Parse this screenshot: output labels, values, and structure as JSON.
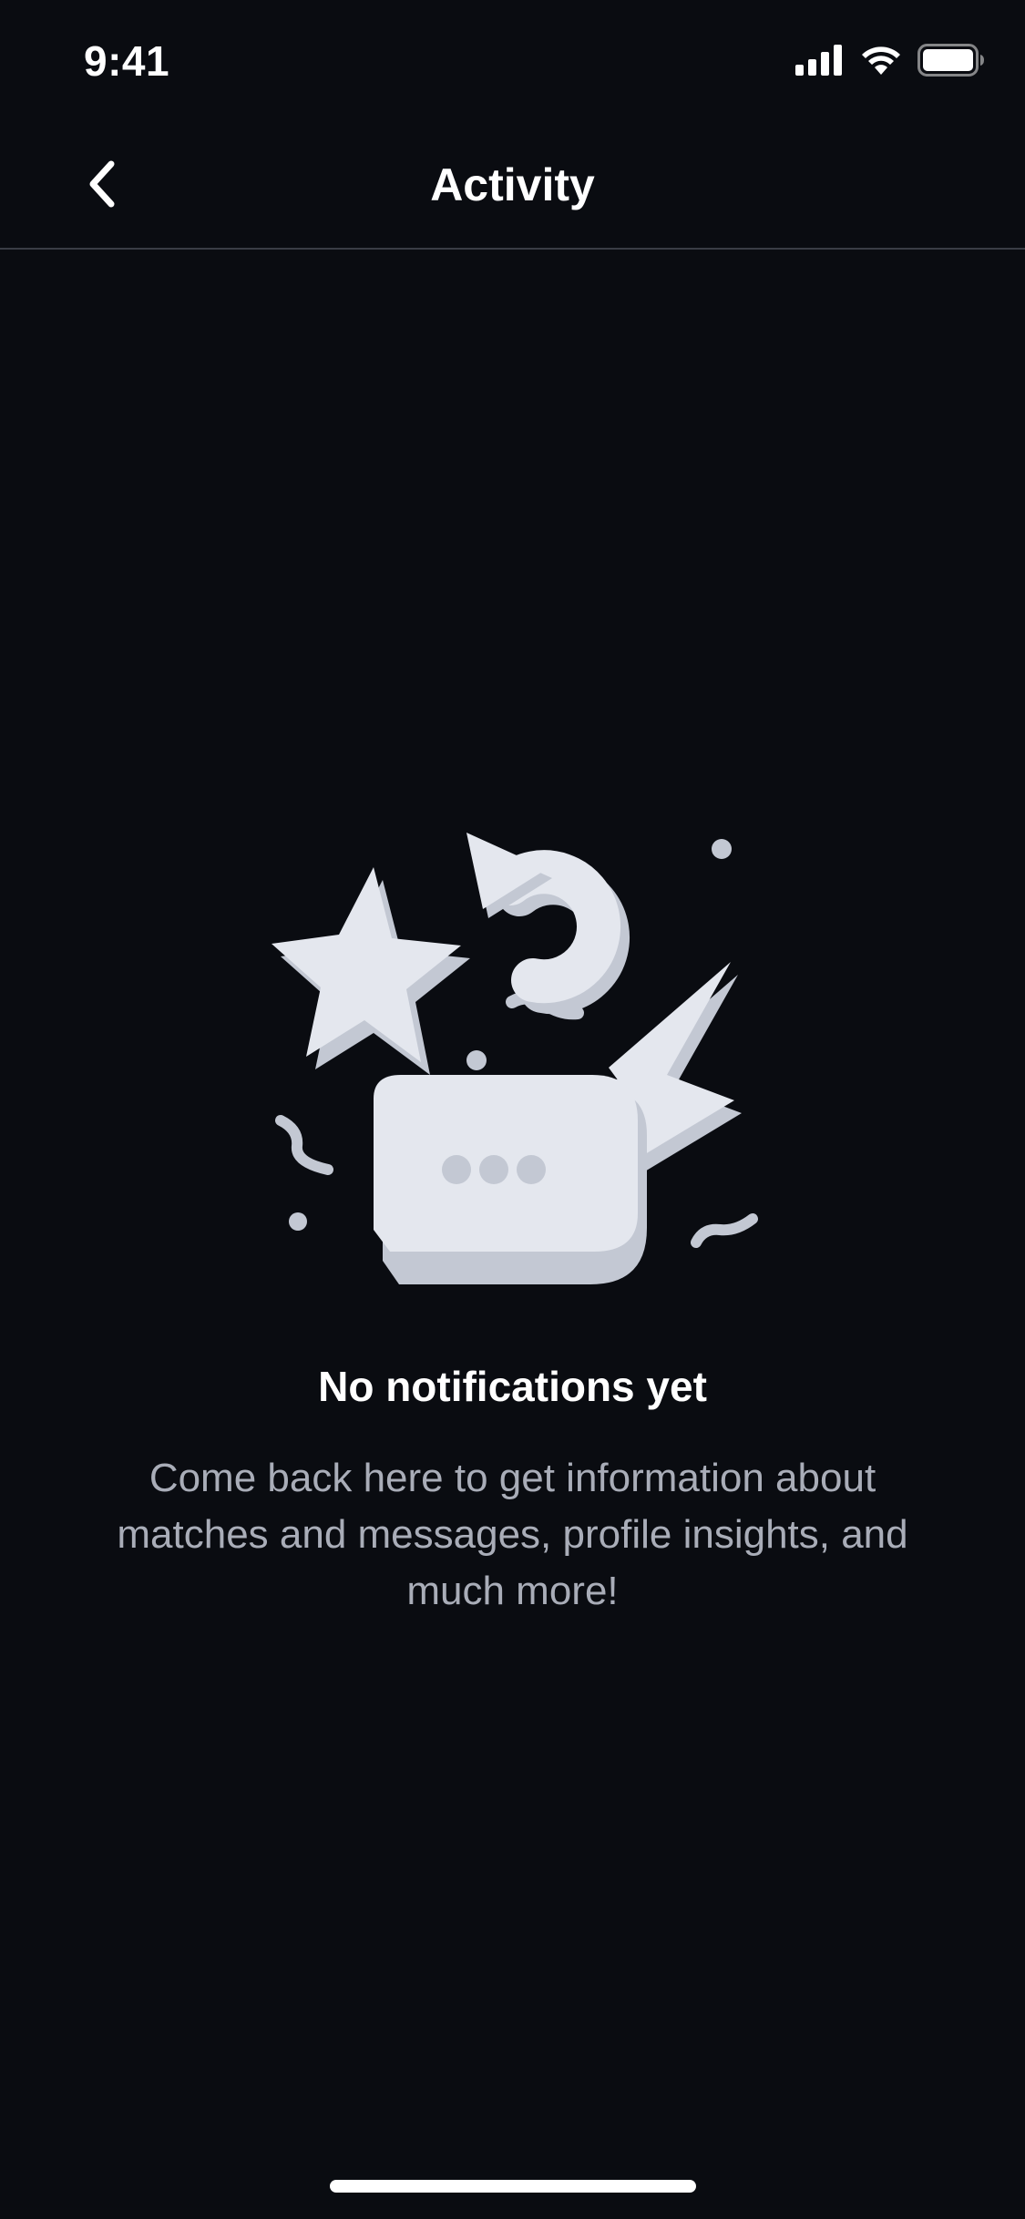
{
  "status_bar": {
    "time": "9:41",
    "icons": [
      "cellular-signal-icon",
      "wifi-icon",
      "battery-icon"
    ]
  },
  "nav": {
    "back_icon": "chevron-left-icon",
    "title": "Activity"
  },
  "empty_state": {
    "illustration": "activity-illustration",
    "title": "No notifications yet",
    "body": "Come back here to get information about matches and messages, profile insights, and much more!"
  },
  "colors": {
    "background": "#0A0C11",
    "text_primary": "#FFFFFF",
    "text_secondary": "#A9ADB8",
    "divider": "#3A3D45",
    "illustration_light": "#E4E7EE",
    "illustration_shade": "#C3C8D3"
  }
}
